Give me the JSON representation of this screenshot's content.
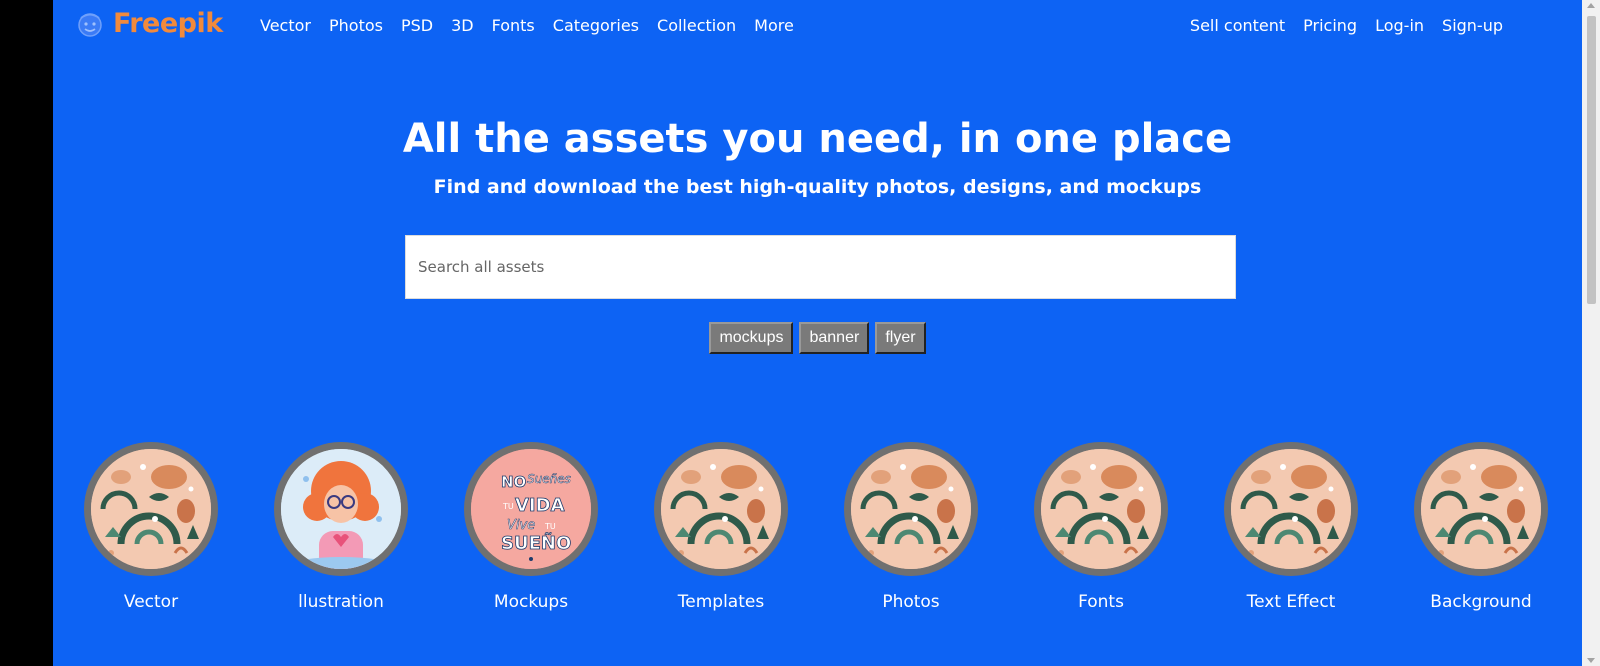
{
  "brand": {
    "name": "Freepik",
    "color": "#f28a3c"
  },
  "nav": {
    "left": [
      "Vector",
      "Photos",
      "PSD",
      "3D",
      "Fonts",
      "Categories",
      "Collection",
      "More"
    ],
    "right": [
      "Sell content",
      "Pricing",
      "Log-in",
      "Sign-up"
    ]
  },
  "hero": {
    "title": "All the assets you need, in one place",
    "subtitle": "Find and download the best high-quality photos, designs, and mockups"
  },
  "search": {
    "placeholder": "Search all assets",
    "value": ""
  },
  "tags": [
    "mockups",
    "banner",
    "flyer"
  ],
  "categories": [
    {
      "label": "Vector",
      "image": "pattern"
    },
    {
      "label": "llustration",
      "image": "girl-illustration"
    },
    {
      "label": "Mockups",
      "image": "lettering",
      "lettering": [
        "NO",
        "Sueñes",
        "TU",
        "VIDA",
        "Vive",
        "TU",
        "SUEÑO"
      ]
    },
    {
      "label": "Templates",
      "image": "pattern"
    },
    {
      "label": "Photos",
      "image": "pattern"
    },
    {
      "label": "Fonts",
      "image": "pattern"
    },
    {
      "label": "Text Effect",
      "image": "pattern"
    },
    {
      "label": "Background",
      "image": "pattern"
    }
  ],
  "colors": {
    "background": "#0d63f4",
    "tag_bg": "#7a7a7a",
    "circle_border": "#707070"
  }
}
